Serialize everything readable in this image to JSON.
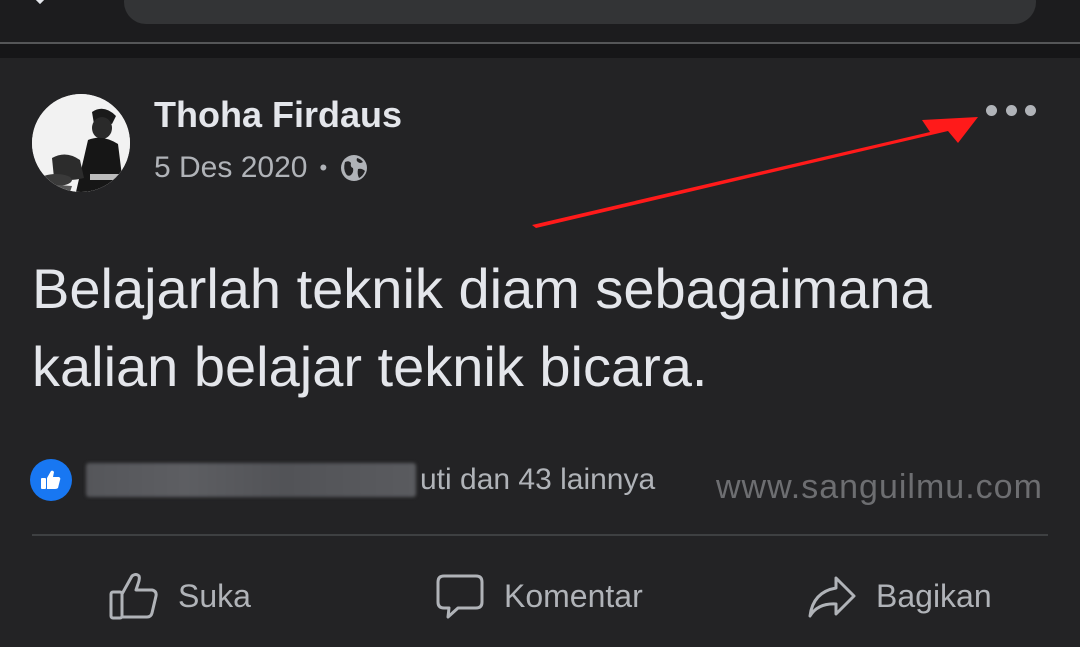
{
  "post": {
    "author": "Thoha Firdaus",
    "date": "5 Des 2020",
    "separator": "•",
    "privacy_icon": "globe-icon",
    "text_lines": [
      "Belajarlah teknik diam sebagaimana",
      "kalian belajar teknik bicara."
    ]
  },
  "reactions": {
    "icon": "like-icon",
    "summary_suffix": "uti dan 43 lainnya"
  },
  "watermark": "www.sanguilmu.com",
  "actions": {
    "like_label": "Suka",
    "comment_label": "Komentar",
    "share_label": "Bagikan"
  },
  "colors": {
    "background": "#232325",
    "accent_arrow": "#ff1a1a",
    "like_blue": "#1877f2",
    "text_primary": "#e4e6eb",
    "text_secondary": "#b0b3b8"
  }
}
